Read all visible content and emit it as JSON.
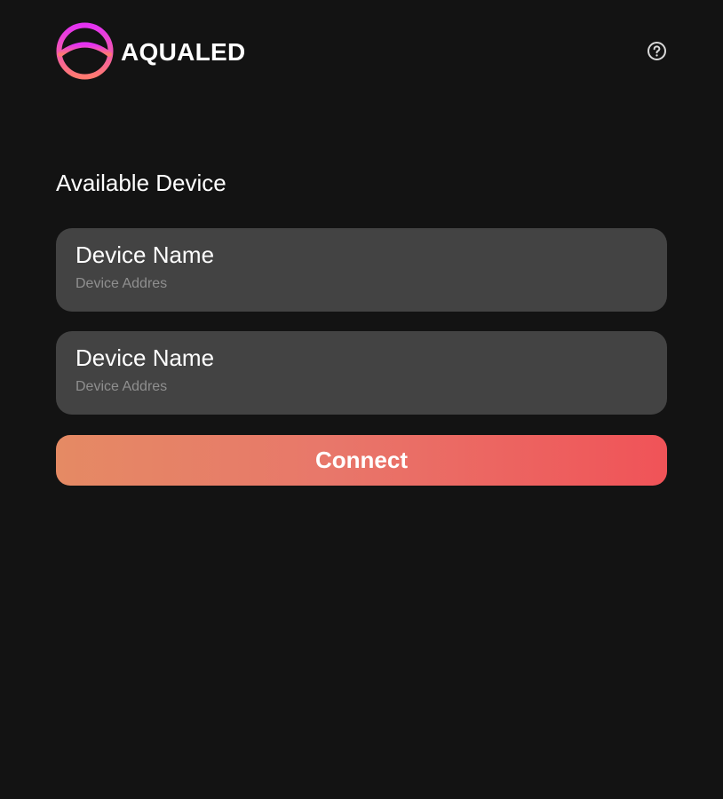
{
  "header": {
    "brand_name": "AQUALED",
    "logo_icon": "aqualed-logo",
    "help_icon": "question-circle-icon"
  },
  "main": {
    "section_title": "Available Device",
    "devices": [
      {
        "name": "Device Name",
        "address": "Device Addres"
      },
      {
        "name": "Device Name",
        "address": "Device Addres"
      }
    ],
    "connect_label": "Connect"
  },
  "colors": {
    "background": "#131313",
    "card": "#434343",
    "address_text": "#8f8f8f",
    "button_gradient_start": "#e58a64",
    "button_gradient_end": "#f05358",
    "logo_gradient_top": "#e432f2",
    "logo_gradient_bottom": "#ff7a70"
  }
}
